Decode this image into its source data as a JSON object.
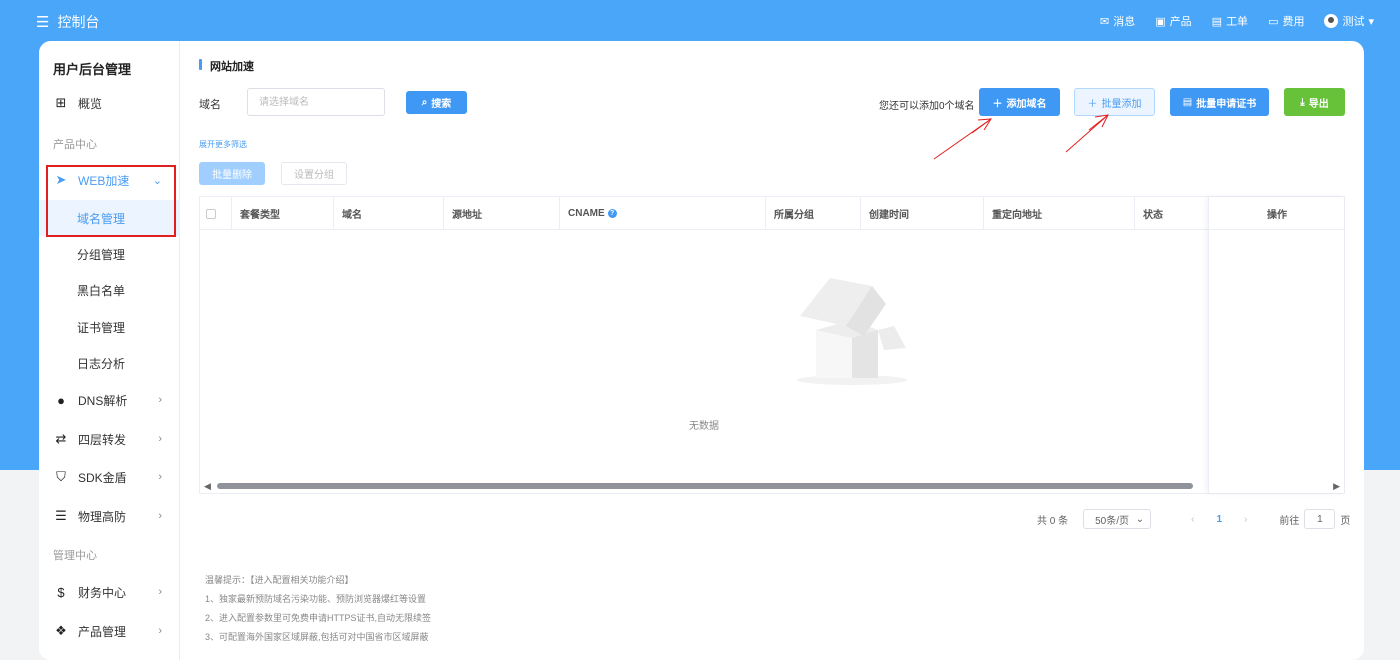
{
  "topbar": {
    "title": "控制台",
    "nav": [
      {
        "icon": "mail-icon",
        "label": "消息"
      },
      {
        "icon": "box-icon",
        "label": "产品"
      },
      {
        "icon": "ticket-icon",
        "label": "工单"
      },
      {
        "icon": "folder-icon",
        "label": "费用"
      }
    ],
    "user": "测试"
  },
  "sidebar": {
    "title": "用户后台管理",
    "overview": "概览",
    "section_products": "产品中心",
    "web_accel": "WEB加速",
    "web_sub": [
      "域名管理",
      "分组管理",
      "黑白名单",
      "证书管理",
      "日志分析"
    ],
    "dns": "DNS解析",
    "l4": "四层转发",
    "sdk": "SDK金盾",
    "physical": "物理高防",
    "section_manage": "管理中心",
    "finance": "财务中心",
    "product_mgmt": "产品管理"
  },
  "main": {
    "title": "网站加速",
    "filter_label": "域名",
    "filter_placeholder": "请选择域名",
    "search": "搜索",
    "remaining": "您还可以添加0个域名",
    "add_domain": "添加域名",
    "bulk_add": "批量添加",
    "bulk_cert": "批量申请证书",
    "export": "导出",
    "expand_filters": "展开更多筛选",
    "bulk_delete": "批量删除",
    "set_group": "设置分组"
  },
  "table": {
    "columns": [
      "套餐类型",
      "域名",
      "源地址",
      "CNAME",
      "所属分组",
      "创建时间",
      "重定向地址",
      "状态"
    ],
    "operation": "操作",
    "empty": "无数据"
  },
  "pagination": {
    "total": "共 0 条",
    "page_size": "50条/页",
    "current": "1",
    "goto_label": "前往",
    "goto_value": "1",
    "page_unit": "页"
  },
  "tips": [
    "温馨提示：【进入配置相关功能介绍】",
    "1、独家最新预防域名污染功能、预防浏览器爆红等设置",
    "2、进入配置参数里可免费申请HTTPS证书,自动无限续签",
    "3、可配置海外国家区域屏蔽,包括可对中国省市区域屏蔽"
  ],
  "colors": {
    "header": "#4aa6f8",
    "primary": "#3f98f3",
    "success": "#67c23a",
    "annotation": "#e02020"
  }
}
